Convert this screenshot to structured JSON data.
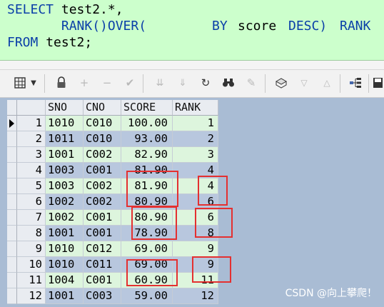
{
  "sql": {
    "line1_kw": "SELECT",
    "line1_rest": " test2.*,",
    "line2_a": "       RANK()OVER(",
    "line2_b": "BY",
    "line2_c": "score",
    "line2_d": "DESC)",
    "line2_e": "RANK",
    "line3_kw": "FROM",
    "line3_rest": " test2;"
  },
  "toolbar": {
    "icons": [
      "grid-icon",
      "dropdown-icon",
      "lock-icon",
      "add-icon",
      "remove-icon",
      "check-icon",
      "filter-down-icon",
      "filter-all-icon",
      "refresh-icon",
      "binoculars-icon",
      "clear-icon",
      "print-icon",
      "arrow-down-icon",
      "arrow-up-icon",
      "tree-icon",
      "save-icon"
    ]
  },
  "grid": {
    "columns": [
      "SNO",
      "CNO",
      "SCORE",
      "RANK"
    ],
    "rows": [
      {
        "num": "1",
        "sno": "1010",
        "cno": "C010",
        "score": "100.00",
        "rank": "1"
      },
      {
        "num": "2",
        "sno": "1011",
        "cno": "C010",
        "score": "93.00",
        "rank": "2"
      },
      {
        "num": "3",
        "sno": "1001",
        "cno": "C002",
        "score": "82.90",
        "rank": "3"
      },
      {
        "num": "4",
        "sno": "1003",
        "cno": "C001",
        "score": "81.90",
        "rank": "4"
      },
      {
        "num": "5",
        "sno": "1003",
        "cno": "C002",
        "score": "81.90",
        "rank": "4"
      },
      {
        "num": "6",
        "sno": "1002",
        "cno": "C002",
        "score": "80.90",
        "rank": "6"
      },
      {
        "num": "7",
        "sno": "1002",
        "cno": "C001",
        "score": "80.90",
        "rank": "6"
      },
      {
        "num": "8",
        "sno": "1001",
        "cno": "C001",
        "score": "78.90",
        "rank": "8"
      },
      {
        "num": "9",
        "sno": "1010",
        "cno": "C012",
        "score": "69.00",
        "rank": "9"
      },
      {
        "num": "10",
        "sno": "1010",
        "cno": "C011",
        "score": "69.00",
        "rank": "9"
      },
      {
        "num": "11",
        "sno": "1004",
        "cno": "C001",
        "score": "60.90",
        "rank": "11"
      },
      {
        "num": "12",
        "sno": "1001",
        "cno": "C003",
        "score": "59.00",
        "rank": "12"
      }
    ]
  },
  "watermark": "CSDN @向上攀爬！",
  "colors": {
    "editor_bg": "#ccffcc",
    "keyword": "#0a3fa8",
    "row_green": "#ddf5dd",
    "row_blue": "#b8c7de",
    "highlight": "#e43030"
  }
}
